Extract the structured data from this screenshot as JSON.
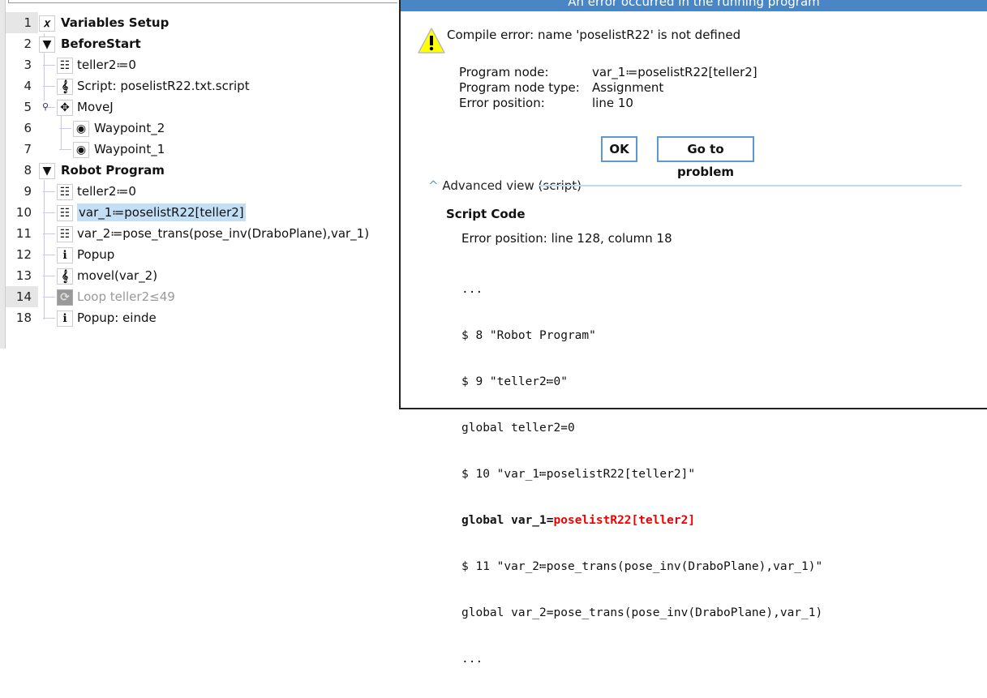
{
  "tree": [
    {
      "num": "1",
      "icon": "variables-icon",
      "glyph": "𝑥",
      "label": "Variables Setup",
      "level": 0,
      "bold": true
    },
    {
      "num": "2",
      "icon": "collapse-triangle-icon",
      "glyph": "▼",
      "label": "BeforeStart",
      "level": 0,
      "bold": true
    },
    {
      "num": "3",
      "icon": "assignment-icon",
      "glyph": "☷",
      "label": "teller2≔0",
      "level": 1
    },
    {
      "num": "4",
      "icon": "script-icon",
      "glyph": "𝄞",
      "label": "Script: poselistR22.txt.script",
      "level": 1
    },
    {
      "num": "5",
      "icon": "move-icon",
      "glyph": "✥",
      "label": "MoveJ",
      "level": 1
    },
    {
      "num": "6",
      "icon": "waypoint-icon",
      "glyph": "◉",
      "label": "Waypoint_2",
      "level": 2
    },
    {
      "num": "7",
      "icon": "waypoint-icon",
      "glyph": "◉",
      "label": "Waypoint_1",
      "level": 2
    },
    {
      "num": "8",
      "icon": "collapse-triangle-icon",
      "glyph": "▼",
      "label": "Robot Program",
      "level": 0,
      "bold": true
    },
    {
      "num": "9",
      "icon": "assignment-icon",
      "glyph": "☷",
      "label": "teller2≔0",
      "level": 1
    },
    {
      "num": "10",
      "icon": "assignment-icon",
      "glyph": "☷",
      "label": "var_1≔poselistR22[teller2]",
      "level": 1,
      "selected": true
    },
    {
      "num": "11",
      "icon": "assignment-icon",
      "glyph": "☷",
      "label": "var_2≔pose_trans(pose_inv(DraboPlane),var_1)",
      "level": 1
    },
    {
      "num": "12",
      "icon": "popup-icon",
      "glyph": "ℹ",
      "label": "Popup",
      "level": 1
    },
    {
      "num": "13",
      "icon": "script-icon",
      "glyph": "𝄞",
      "label": "movel(var_2)",
      "level": 1
    },
    {
      "num": "14",
      "icon": "loop-icon",
      "glyph": "⟳",
      "label": "Loop teller2≤49",
      "level": 1,
      "disabled": true
    },
    {
      "num": "18",
      "icon": "popup-icon",
      "glyph": "ℹ",
      "label": "Popup: einde",
      "level": 1
    }
  ],
  "dialog": {
    "title": "An error occurred in the running program",
    "message": "Compile error: name 'poselistR22' is not defined",
    "details": [
      {
        "key": "Program node:",
        "value": "var_1≔poselistR22[teller2]"
      },
      {
        "key": "Program node type:",
        "value": "Assignment"
      },
      {
        "key": "Error position:",
        "value": "line 10"
      }
    ],
    "ok_label": "OK",
    "goto_label": "Go to problem",
    "advanced_label": "Advanced view (script)",
    "script_title": "Script Code",
    "script_error_position": "Error position: line 128, column 18",
    "code_lines": [
      "...",
      "$ 8 \"Robot Program\"",
      "$ 9 \"teller2≔0\"",
      "global teller2=0",
      "$ 10 \"var_1≔poselistR22[teller2]\"",
      "",
      "$ 11 \"var_2≔pose_trans(pose_inv(DraboPlane),var_1)\"",
      "global var_2=pose_trans(pose_inv(DraboPlane),var_1)",
      "..."
    ],
    "error_line_prefix": "global var_1=",
    "error_line_highlight": "poselistR22[teller2]",
    "colors": {
      "title_bar": "#4a86c5",
      "error_text": "#e00000",
      "selection": "#c3dff5"
    }
  }
}
